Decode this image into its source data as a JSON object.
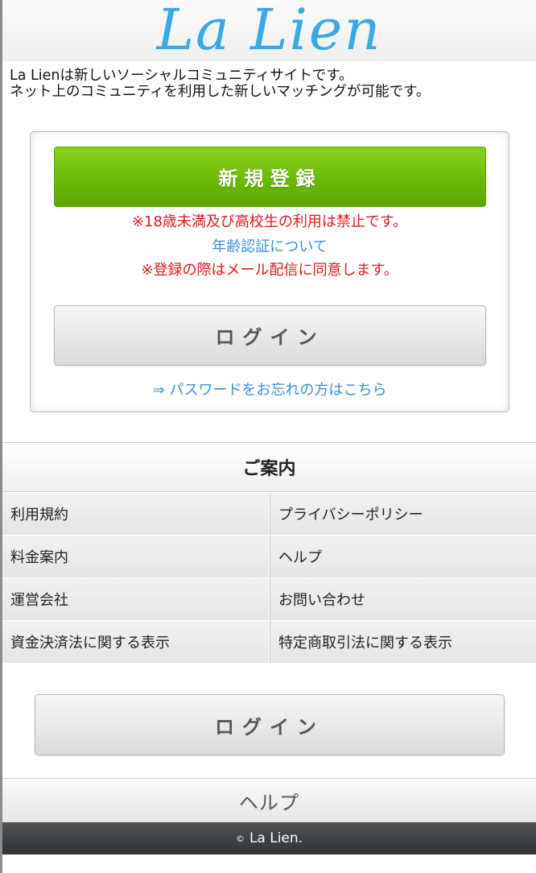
{
  "header": {
    "logo_text": "La Lien"
  },
  "intro": {
    "line1": "La Lienは新しいソーシャルコミュニティサイトです。",
    "line2": "ネット上のコミュニティを利用した新しいマッチングが可能です。"
  },
  "auth": {
    "register_label": "新規登録",
    "notice_age": "※18歳未満及び高校生の利用は禁止です。",
    "age_verify_link": "年齢認証について",
    "notice_mail": "※登録の際はメール配信に同意します。",
    "login_label": "ログイン",
    "forgot_arrow": "⇒",
    "forgot_link": "パスワードをお忘れの方はこちら"
  },
  "guide": {
    "title": "ご案内",
    "items": [
      "利用規約",
      "プライバシーポリシー",
      "料金案内",
      "ヘルプ",
      "運営会社",
      "お問い合わせ",
      "資金決済法に関する表示",
      "特定商取引法に関する表示"
    ]
  },
  "bottom": {
    "login_label": "ログイン",
    "help_label": "ヘルプ"
  },
  "footer": {
    "copyright_symbol": "©",
    "copyright_text": "La Lien."
  }
}
